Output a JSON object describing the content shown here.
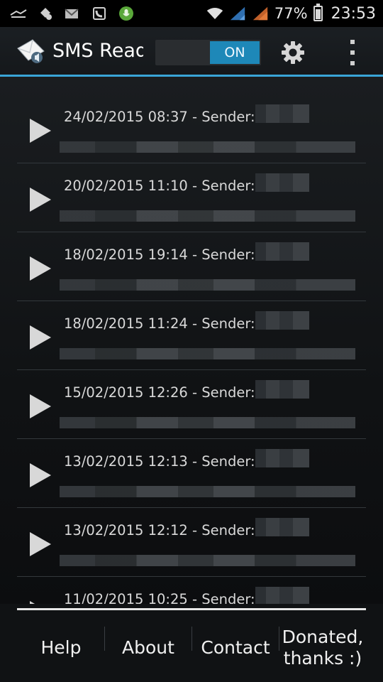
{
  "status_bar": {
    "battery_percent_label": "77%",
    "battery_level": 0.77,
    "time": "23:53",
    "icons": [
      "usb-icon",
      "android-debug-icon",
      "email-notification-icon",
      "call-notification-icon",
      "microphone-icon",
      "wifi-icon",
      "signal-icon",
      "signal-icon",
      "battery-icon"
    ]
  },
  "action_bar": {
    "title": "SMS Reader",
    "toggle_label": "ON",
    "accent_color": "#3aa5d8",
    "toggle_color": "#1e88b8"
  },
  "messages": [
    {
      "timestamp": "24/02/2015 08:37 - Sender:"
    },
    {
      "timestamp": "20/02/2015 11:10 - Sender:"
    },
    {
      "timestamp": "18/02/2015 19:14 - Sender:"
    },
    {
      "timestamp": "18/02/2015 11:24 - Sender:"
    },
    {
      "timestamp": "15/02/2015 12:26 - Sender:"
    },
    {
      "timestamp": "13/02/2015 12:13 - Sender:"
    },
    {
      "timestamp": "13/02/2015 12:12 - Sender:"
    },
    {
      "timestamp": "11/02/2015 10:25 - Sender:"
    }
  ],
  "footer": {
    "help": "Help",
    "about": "About",
    "contact": "Contact",
    "donated_line1": "Donated,",
    "donated_line2": "thanks :)"
  }
}
